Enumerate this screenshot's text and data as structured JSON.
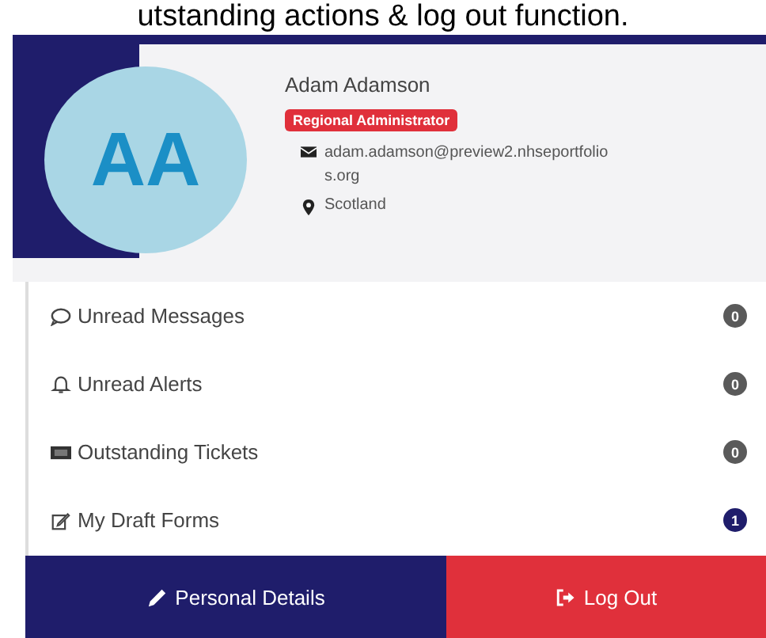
{
  "caption": "utstanding actions & log out function.",
  "profile": {
    "initials": "AA",
    "name": "Adam Adamson",
    "role": "Regional Administrator",
    "email": "adam.adamson@preview2.nhseportfolios.org",
    "location": "Scotland"
  },
  "items": [
    {
      "label": "Unread Messages",
      "kind": "comment",
      "count": "0",
      "color": "#5a5a5a"
    },
    {
      "label": "Unread Alerts",
      "kind": "bell",
      "count": "0",
      "color": "#5a5a5a"
    },
    {
      "label": "Outstanding Tickets",
      "kind": "ticket",
      "count": "0",
      "color": "#5a5a5a"
    },
    {
      "label": "My Draft Forms",
      "kind": "edit",
      "count": "1",
      "color": "#1f1d6b"
    }
  ],
  "buttons": [
    {
      "label": "Personal Details",
      "kind": "primary"
    },
    {
      "label": "Log Out",
      "kind": "danger"
    }
  ]
}
